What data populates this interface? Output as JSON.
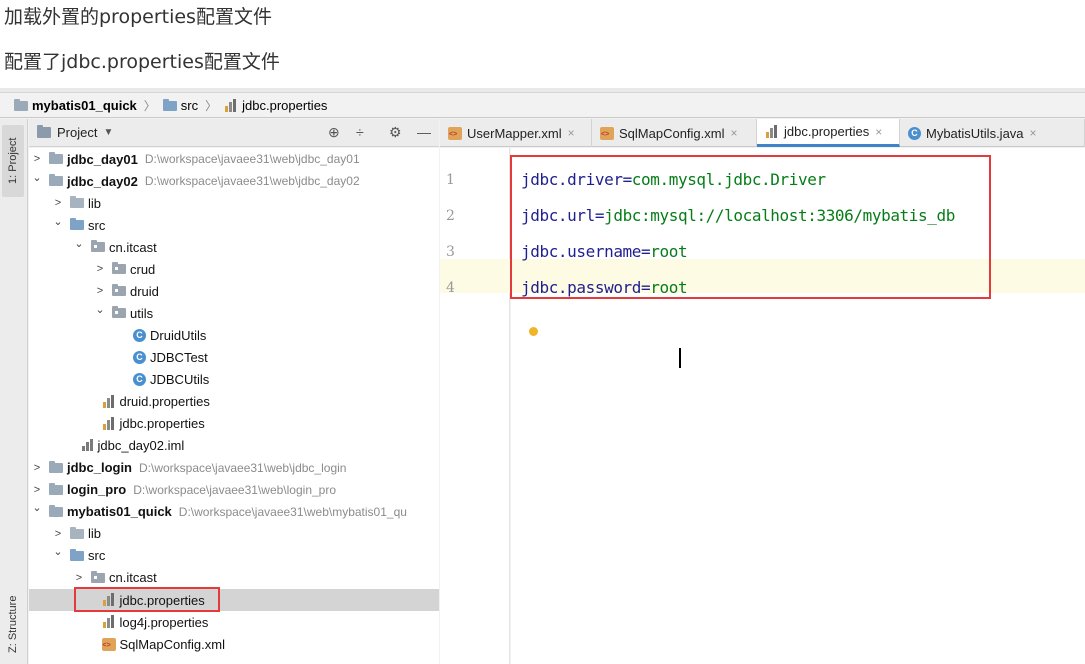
{
  "headings": [
    "加载外置的properties配置文件",
    "配置了jdbc.properties配置文件"
  ],
  "breadcrumb": [
    "mybatis01_quick",
    "src",
    "jdbc.properties"
  ],
  "left_strip": {
    "project_tab": "1: Project",
    "structure_tab": "Z: Structure"
  },
  "project_panel": {
    "title": "Project"
  },
  "tree": [
    {
      "label": "jdbc_day01",
      "path": "D:\\workspace\\javaee31\\web\\jdbc_day01",
      "arrow": "›",
      "bold": true,
      "icon": "module-folder-icon",
      "indent": 0
    },
    {
      "label": "jdbc_day02",
      "path": "D:\\workspace\\javaee31\\web\\jdbc_day02",
      "arrow": "⌄",
      "bold": true,
      "icon": "module-folder-icon",
      "indent": 0
    },
    {
      "label": "lib",
      "path": "",
      "arrow": "›",
      "bold": false,
      "icon": "folder-icon",
      "indent": 1
    },
    {
      "label": "src",
      "path": "",
      "arrow": "⌄",
      "bold": false,
      "icon": "source-folder-icon",
      "indent": 1
    },
    {
      "label": "cn.itcast",
      "path": "",
      "arrow": "⌄",
      "bold": false,
      "icon": "package-icon",
      "indent": 2
    },
    {
      "label": "crud",
      "path": "",
      "arrow": "›",
      "bold": false,
      "icon": "package-icon",
      "indent": 3
    },
    {
      "label": "druid",
      "path": "",
      "arrow": "›",
      "bold": false,
      "icon": "package-icon",
      "indent": 3
    },
    {
      "label": "utils",
      "path": "",
      "arrow": "⌄",
      "bold": false,
      "icon": "package-icon",
      "indent": 3
    },
    {
      "label": "DruidUtils",
      "path": "",
      "arrow": "",
      "bold": false,
      "icon": "class-icon",
      "indent": 4
    },
    {
      "label": "JDBCTest",
      "path": "",
      "arrow": "",
      "bold": false,
      "icon": "class-icon",
      "indent": 4
    },
    {
      "label": "JDBCUtils",
      "path": "",
      "arrow": "",
      "bold": false,
      "icon": "class-icon",
      "indent": 4
    },
    {
      "label": "druid.properties",
      "path": "",
      "arrow": "",
      "bold": false,
      "icon": "properties-file-icon",
      "indent": 2.5
    },
    {
      "label": "jdbc.properties",
      "path": "",
      "arrow": "",
      "bold": false,
      "icon": "properties-file-icon",
      "indent": 2.5
    },
    {
      "label": "jdbc_day02.iml",
      "path": "",
      "arrow": "",
      "bold": false,
      "icon": "iml-file-icon",
      "indent": 1.5
    },
    {
      "label": "jdbc_login",
      "path": "D:\\workspace\\javaee31\\web\\jdbc_login",
      "arrow": "›",
      "bold": true,
      "icon": "module-folder-icon",
      "indent": 0
    },
    {
      "label": "login_pro",
      "path": "D:\\workspace\\javaee31\\web\\login_pro",
      "arrow": "›",
      "bold": true,
      "icon": "module-folder-icon",
      "indent": 0
    },
    {
      "label": "mybatis01_quick",
      "path": "D:\\workspace\\javaee31\\web\\mybatis01_qu",
      "arrow": "⌄",
      "bold": true,
      "icon": "module-folder-icon",
      "indent": 0
    },
    {
      "label": "lib",
      "path": "",
      "arrow": "›",
      "bold": false,
      "icon": "folder-icon",
      "indent": 1
    },
    {
      "label": "src",
      "path": "",
      "arrow": "⌄",
      "bold": false,
      "icon": "source-folder-icon",
      "indent": 1
    },
    {
      "label": "cn.itcast",
      "path": "",
      "arrow": "›",
      "bold": false,
      "icon": "package-icon",
      "indent": 2
    },
    {
      "label": "jdbc.properties",
      "path": "",
      "arrow": "",
      "bold": false,
      "icon": "properties-file-icon",
      "indent": 2.5,
      "selected": true
    },
    {
      "label": "log4j.properties",
      "path": "",
      "arrow": "",
      "bold": false,
      "icon": "properties-file-icon",
      "indent": 2.5
    },
    {
      "label": "SqlMapConfig.xml",
      "path": "",
      "arrow": "",
      "bold": false,
      "icon": "xml-file-icon",
      "indent": 2.5
    }
  ],
  "editor": {
    "tabs": [
      {
        "label": "UserMapper.xml",
        "icon": "xml-file-icon",
        "active": false
      },
      {
        "label": "SqlMapConfig.xml",
        "icon": "xml-file-icon",
        "active": false
      },
      {
        "label": "jdbc.properties",
        "icon": "properties-file-icon",
        "active": true
      },
      {
        "label": "MybatisUtils.java",
        "icon": "class-icon",
        "active": false
      }
    ],
    "lines": [
      {
        "number": "1",
        "key": "jdbc.driver",
        "eq": "=",
        "value": "com.mysql.jdbc.Driver"
      },
      {
        "number": "2",
        "key": "jdbc.url",
        "eq": "=",
        "value": "jdbc:mysql://localhost:3306/mybatis_db"
      },
      {
        "number": "3",
        "key": "jdbc.username",
        "eq": "=",
        "value": "root"
      },
      {
        "number": "4",
        "key": "jdbc.password",
        "eq": "=",
        "value": "root"
      }
    ]
  },
  "colors": {
    "highlight_box": "#e33b3b",
    "key": "#1f1f8f",
    "value": "#067d17",
    "active_tab_underline": "#4083c9"
  }
}
